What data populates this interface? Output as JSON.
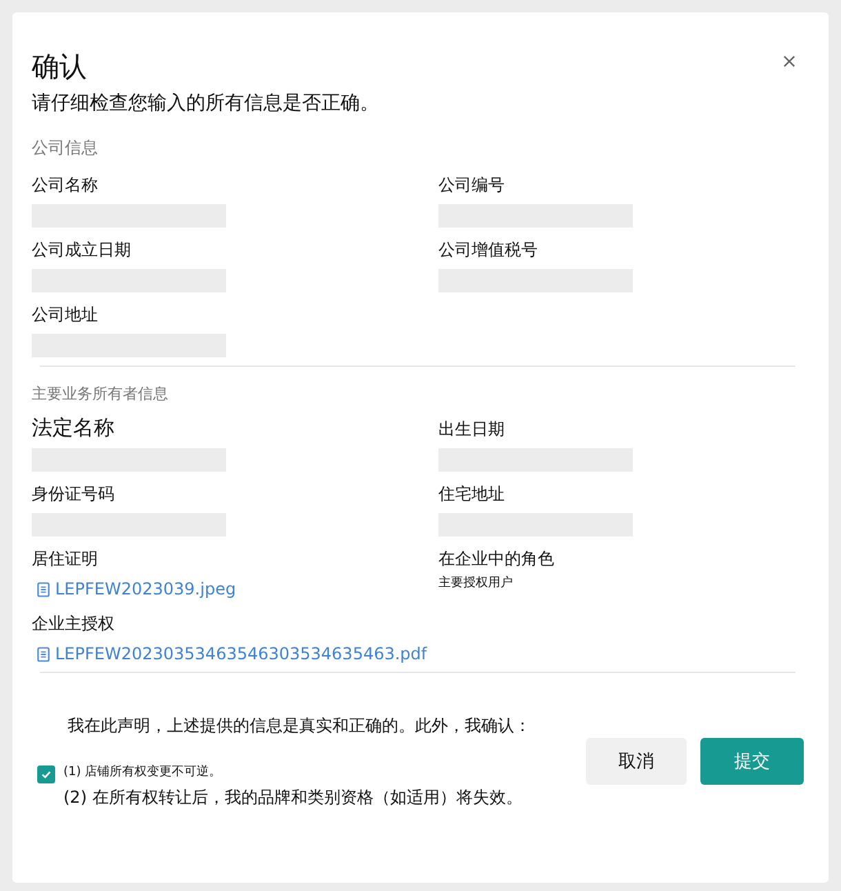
{
  "dialog": {
    "title": "确认",
    "subtitle": "请仔细检查您输入的所有信息是否正确。"
  },
  "sections": [
    {
      "heading": "公司信息",
      "fields": [
        {
          "label": "公司名称",
          "kind": "redacted",
          "prominent": false
        },
        {
          "label": "公司编号",
          "kind": "redacted",
          "prominent": false
        },
        {
          "label": "公司成立日期",
          "kind": "redacted",
          "prominent": false
        },
        {
          "label": "公司增值税号",
          "kind": "redacted",
          "prominent": false
        },
        {
          "label": "公司地址",
          "kind": "redacted",
          "prominent": false
        }
      ]
    },
    {
      "heading": "主要业务所有者信息",
      "fields": [
        {
          "label": "法定名称",
          "kind": "redacted",
          "prominent": true
        },
        {
          "label": "出生日期",
          "kind": "redacted",
          "prominent": false
        },
        {
          "label": "身份证号码",
          "kind": "redacted",
          "prominent": false
        },
        {
          "label": "住宅地址",
          "kind": "redacted",
          "prominent": false
        },
        {
          "label": "居住证明",
          "kind": "file",
          "value": "LEPFEW2023039.jpeg",
          "prominent": false
        },
        {
          "label": "在企业中的角色",
          "kind": "text",
          "value": "主要授权用户",
          "prominent": false
        },
        {
          "label": "企业主授权",
          "kind": "file",
          "value": "LEPFEW20230353463546303534635463.pdf",
          "prominent": false
        }
      ]
    }
  ],
  "declaration": {
    "text": "我在此声明，上述提供的信息是真实和正确的。此外，我确认：",
    "checked": true,
    "items": [
      "(1) 店铺所有权变更不可逆。",
      "(2) 在所有权转让后，我的品牌和类别资格（如适用）将失效。"
    ]
  },
  "buttons": [
    {
      "label": "取消",
      "kind": "secondary"
    },
    {
      "label": "提交",
      "kind": "primary"
    }
  ]
}
